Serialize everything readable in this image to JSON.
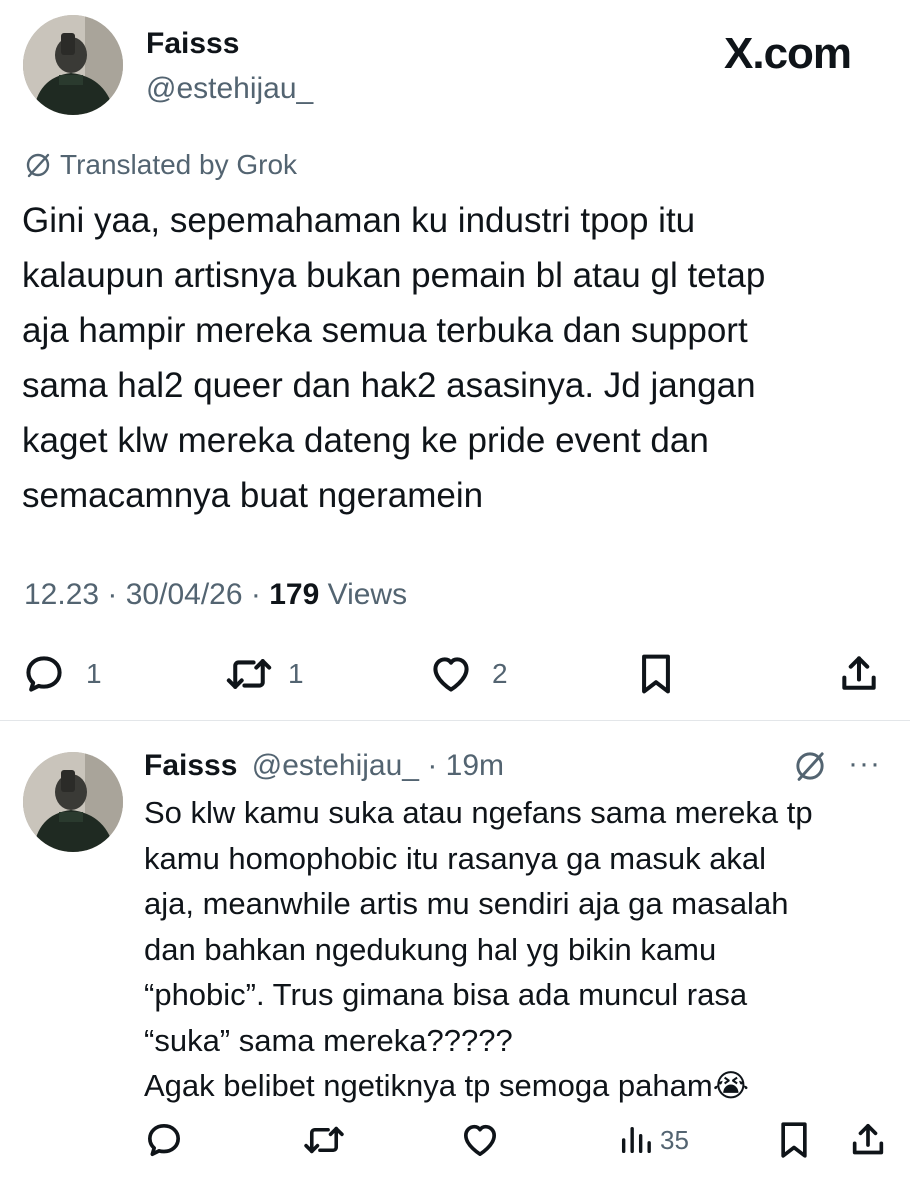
{
  "main_tweet": {
    "author": {
      "name": "Faisss",
      "handle": "@estehijau_"
    },
    "brand": "X.com",
    "translation_label": "Translated by Grok",
    "text_lines": [
      "Gini yaa, sepemahaman ku industri tpop itu",
      "kalaupun artisnya bukan pemain bl atau gl tetap",
      "aja hampir mereka semua terbuka dan support",
      "sama hal2 queer dan hak2 asasinya. Jd jangan",
      "kaget klw mereka dateng ke pride event dan",
      "semacamnya buat ngeramein"
    ],
    "meta": {
      "time": "12.23",
      "sep1": " · ",
      "date": "30/04/26",
      "sep2": " · ",
      "views_count": "179",
      "views_label": " Views"
    },
    "actions": {
      "replies": "1",
      "reposts": "1",
      "likes": "2"
    }
  },
  "reply_tweet": {
    "author": {
      "name": "Faisss",
      "handle": "@estehijau_",
      "time": " · 19m"
    },
    "more_label": "···",
    "text_lines": [
      "So klw kamu suka atau ngefans sama mereka tp",
      "kamu homophobic itu rasanya ga masuk akal",
      "aja, meanwhile artis mu sendiri aja ga masalah",
      "dan bahkan ngedukung hal yg bikin kamu",
      "“phobic”. Trus gimana bisa ada muncul rasa",
      "“suka” sama mereka?????",
      "Agak belibet ngetiknya tp semoga paham😭"
    ],
    "actions": {
      "views": "35"
    }
  }
}
